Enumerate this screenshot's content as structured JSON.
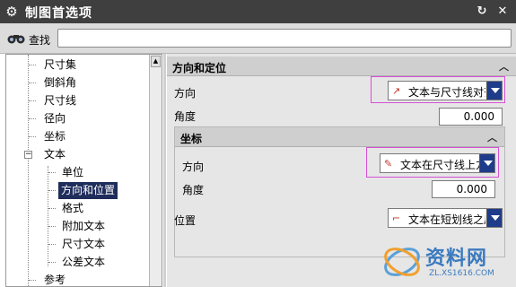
{
  "window": {
    "title": "制图首选项"
  },
  "search": {
    "label": "查找",
    "placeholder": ""
  },
  "tree": {
    "items": [
      {
        "label": "尺寸集"
      },
      {
        "label": "倒斜角"
      },
      {
        "label": "尺寸线"
      },
      {
        "label": "径向"
      },
      {
        "label": "坐标"
      },
      {
        "label": "文本"
      },
      {
        "label": "单位"
      },
      {
        "label": "方向和位置",
        "selected": true
      },
      {
        "label": "格式"
      },
      {
        "label": "附加文本"
      },
      {
        "label": "尺寸文本"
      },
      {
        "label": "公差文本"
      },
      {
        "label": "参考"
      }
    ],
    "expander_symbol": "−"
  },
  "panel": {
    "section_title": "方向和定位",
    "orientation_label": "方向",
    "orientation_value": "文本与尺寸线对齐",
    "angle_label": "角度",
    "angle_value": "0.000",
    "coord": {
      "title": "坐标",
      "orientation_label": "方向",
      "orientation_value": "文本在尺寸线上方",
      "angle_label": "角度",
      "angle_value": "0.000"
    },
    "position_label": "位置",
    "position_value": "文本在短划线之后"
  },
  "watermark": {
    "brand": "资料网",
    "site": "ZL.XS1616.COM"
  },
  "colors": {
    "accent": "#1f3c8a",
    "highlight": "#d64fd6",
    "selection": "#1f2d5b",
    "titlebar": "#3f3f3f"
  },
  "icons": [
    "gear-icon",
    "reset-icon",
    "close-icon",
    "binoculars-icon",
    "collapse-icon",
    "dropdown-arrow-icon",
    "text-align-icon",
    "text-above-icon",
    "text-after-leader-icon"
  ]
}
